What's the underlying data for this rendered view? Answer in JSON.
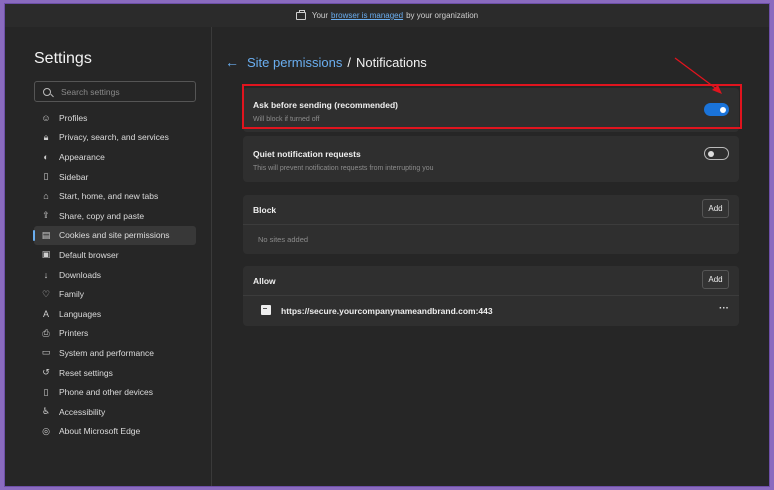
{
  "infobar": {
    "prefix": "Your",
    "link": "browser is managed",
    "suffix": "by your organization"
  },
  "sidebar": {
    "title": "Settings",
    "search_placeholder": "Search settings",
    "items": [
      {
        "label": "Profiles",
        "icon": "profile-icon",
        "glyph": "☺"
      },
      {
        "label": "Privacy, search, and services",
        "icon": "lock-icon",
        "glyph": "🔒︎"
      },
      {
        "label": "Appearance",
        "icon": "appearance-icon",
        "glyph": "◐"
      },
      {
        "label": "Sidebar",
        "icon": "sidebar-icon",
        "glyph": "▯"
      },
      {
        "label": "Start, home, and new tabs",
        "icon": "home-icon",
        "glyph": "⌂"
      },
      {
        "label": "Share, copy and paste",
        "icon": "share-icon",
        "glyph": "⇪"
      },
      {
        "label": "Cookies and site permissions",
        "icon": "cookies-icon",
        "glyph": "▤",
        "active": true
      },
      {
        "label": "Default browser",
        "icon": "default-browser-icon",
        "glyph": "▣"
      },
      {
        "label": "Downloads",
        "icon": "download-icon",
        "glyph": "↓"
      },
      {
        "label": "Family",
        "icon": "family-icon",
        "glyph": "♡"
      },
      {
        "label": "Languages",
        "icon": "languages-icon",
        "glyph": "A"
      },
      {
        "label": "Printers",
        "icon": "printer-icon",
        "glyph": "⎙"
      },
      {
        "label": "System and performance",
        "icon": "system-icon",
        "glyph": "▭"
      },
      {
        "label": "Reset settings",
        "icon": "reset-icon",
        "glyph": "↺"
      },
      {
        "label": "Phone and other devices",
        "icon": "phone-icon",
        "glyph": "▯"
      },
      {
        "label": "Accessibility",
        "icon": "accessibility-icon",
        "glyph": "♿︎"
      },
      {
        "label": "About Microsoft Edge",
        "icon": "edge-icon",
        "glyph": "◎"
      }
    ]
  },
  "header": {
    "parent": "Site permissions",
    "separator": "/",
    "title": "Notifications"
  },
  "ask": {
    "title": "Ask before sending (recommended)",
    "subtitle": "Will block if turned off",
    "enabled": true
  },
  "quiet": {
    "title": "Quiet notification requests",
    "subtitle": "This will prevent notification requests from interrupting you",
    "enabled": false
  },
  "block": {
    "title": "Block",
    "add_label": "Add",
    "empty_text": "No sites added"
  },
  "allow": {
    "title": "Allow",
    "add_label": "Add",
    "sites": [
      {
        "url": "https://secure.yourcompanynameandbrand.com:443",
        "more": "···"
      }
    ]
  },
  "colors": {
    "accent": "#6aaef0",
    "toggle_on": "#1a73d9",
    "highlight": "#e0141e"
  }
}
